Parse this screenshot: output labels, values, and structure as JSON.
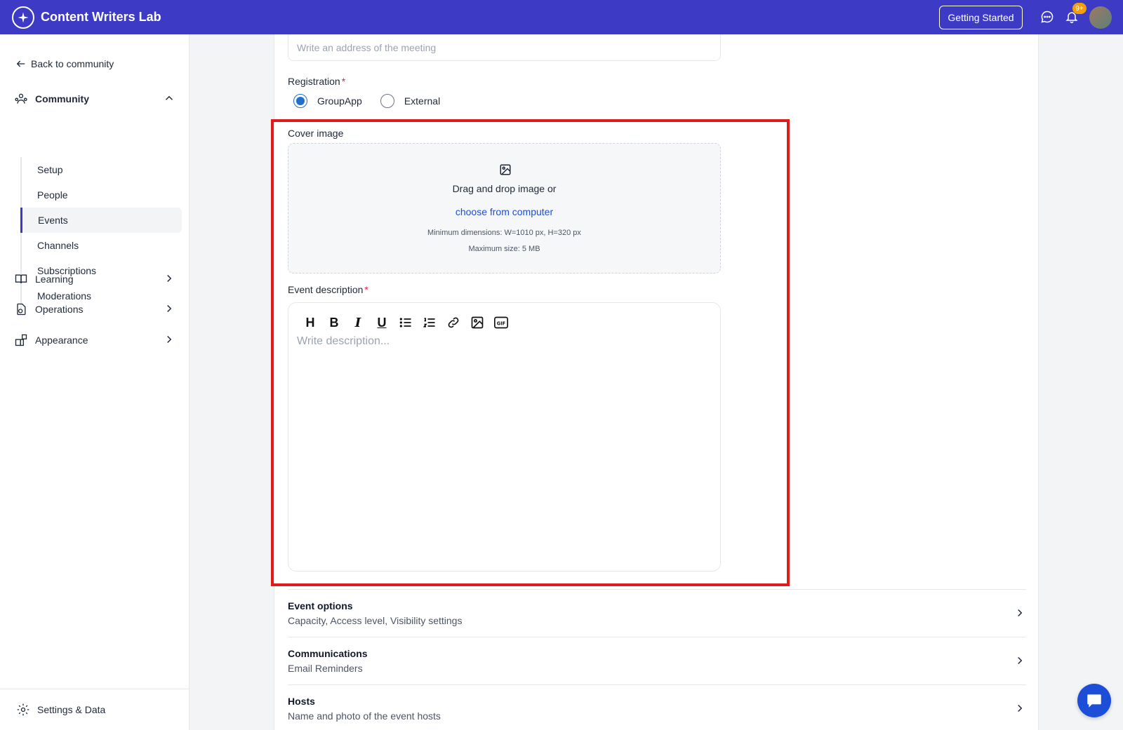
{
  "app": {
    "name": "Content Writers Lab",
    "getting_started": "Getting Started",
    "notification_count": "9+"
  },
  "sidebar": {
    "back_label": "Back to community",
    "community_label": "Community",
    "community_items": [
      {
        "label": "Setup"
      },
      {
        "label": "People"
      },
      {
        "label": "Events",
        "active": true
      },
      {
        "label": "Channels"
      },
      {
        "label": "Subscriptions"
      },
      {
        "label": "Moderations"
      }
    ],
    "sections": [
      {
        "label": "Learning",
        "icon": "book-icon"
      },
      {
        "label": "Operations",
        "icon": "operations-icon"
      },
      {
        "label": "Appearance",
        "icon": "appearance-icon"
      }
    ],
    "settings_label": "Settings & Data"
  },
  "form": {
    "address_placeholder": "Write an address of the meeting",
    "registration_label": "Registration",
    "registration_options": [
      {
        "label": "GroupApp",
        "checked": true
      },
      {
        "label": "External",
        "checked": false
      }
    ],
    "cover_label": "Cover image",
    "dropzone": {
      "text": "Drag and drop image or",
      "link": "choose from computer",
      "hint_dimensions": "Minimum dimensions: W=1010 px, H=320 px",
      "hint_size": "Maximum size: 5 MB"
    },
    "description_label": "Event description",
    "description_placeholder": "Write description...",
    "required_mark": "*"
  },
  "options": [
    {
      "title": "Event options",
      "subtitle": "Capacity, Access level, Visibility settings"
    },
    {
      "title": "Communications",
      "subtitle": "Email Reminders"
    },
    {
      "title": "Hosts",
      "subtitle": "Name and photo of the event hosts"
    }
  ],
  "colors": {
    "topbar": "#3d3bc6",
    "active_accent": "#3d3bc6",
    "link": "#1d4ed8",
    "highlight": "#e01b1b"
  }
}
